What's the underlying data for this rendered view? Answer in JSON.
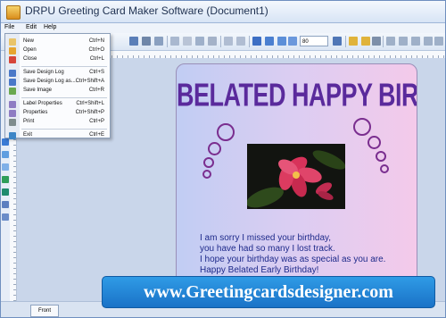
{
  "window": {
    "title": "DRPU Greeting Card Maker Software  (Document1)"
  },
  "menu": {
    "items": [
      "File",
      "Edit",
      "Help"
    ]
  },
  "toolbar": {
    "zoom_value": "80"
  },
  "file_menu": {
    "groups": [
      [
        {
          "label": "New",
          "shortcut": "Ctrl+N",
          "icon": "new-document-icon",
          "color": "#e9c46a"
        },
        {
          "label": "Open",
          "shortcut": "Ctrl+O",
          "icon": "open-folder-icon",
          "color": "#e6a531"
        },
        {
          "label": "Close",
          "shortcut": "Ctrl+L",
          "icon": "close-icon",
          "color": "#d6453a"
        }
      ],
      [
        {
          "label": "Save Design Log",
          "shortcut": "Ctrl+S",
          "icon": "save-icon",
          "color": "#4a78c8"
        },
        {
          "label": "Save Design Log as...",
          "shortcut": "Ctrl+Shift+A",
          "icon": "save-as-icon",
          "color": "#4a78c8"
        },
        {
          "label": "Save Image",
          "shortcut": "Ctrl+R",
          "icon": "save-image-icon",
          "color": "#6aa84f"
        }
      ],
      [
        {
          "label": "Label Properties",
          "shortcut": "Ctrl+Shift+L",
          "icon": "label-properties-icon",
          "color": "#8e7cc3"
        },
        {
          "label": "Properties",
          "shortcut": "Ctrl+Shift+P",
          "icon": "properties-icon",
          "color": "#8e7cc3"
        },
        {
          "label": "Print",
          "shortcut": "Ctrl+P",
          "icon": "print-icon",
          "color": "#7f8c8d"
        }
      ],
      [
        {
          "label": "Exit",
          "shortcut": "Ctrl+E",
          "icon": "exit-icon",
          "color": "#3d85c6"
        }
      ]
    ]
  },
  "card": {
    "title": "BELATED HAPPY BIRTHDAY",
    "message": [
      "I am sorry I missed your birthday,",
      "you have had so many I lost track.",
      "I hope your birthday was as special as you are.",
      "Happy Belated Early Birthday!"
    ],
    "title_color": "#5a2a9c",
    "text_color": "#1e2a8a"
  },
  "tabs": {
    "front": "Front"
  },
  "banner": {
    "text": "www.Greetingcardsdesigner.com"
  }
}
